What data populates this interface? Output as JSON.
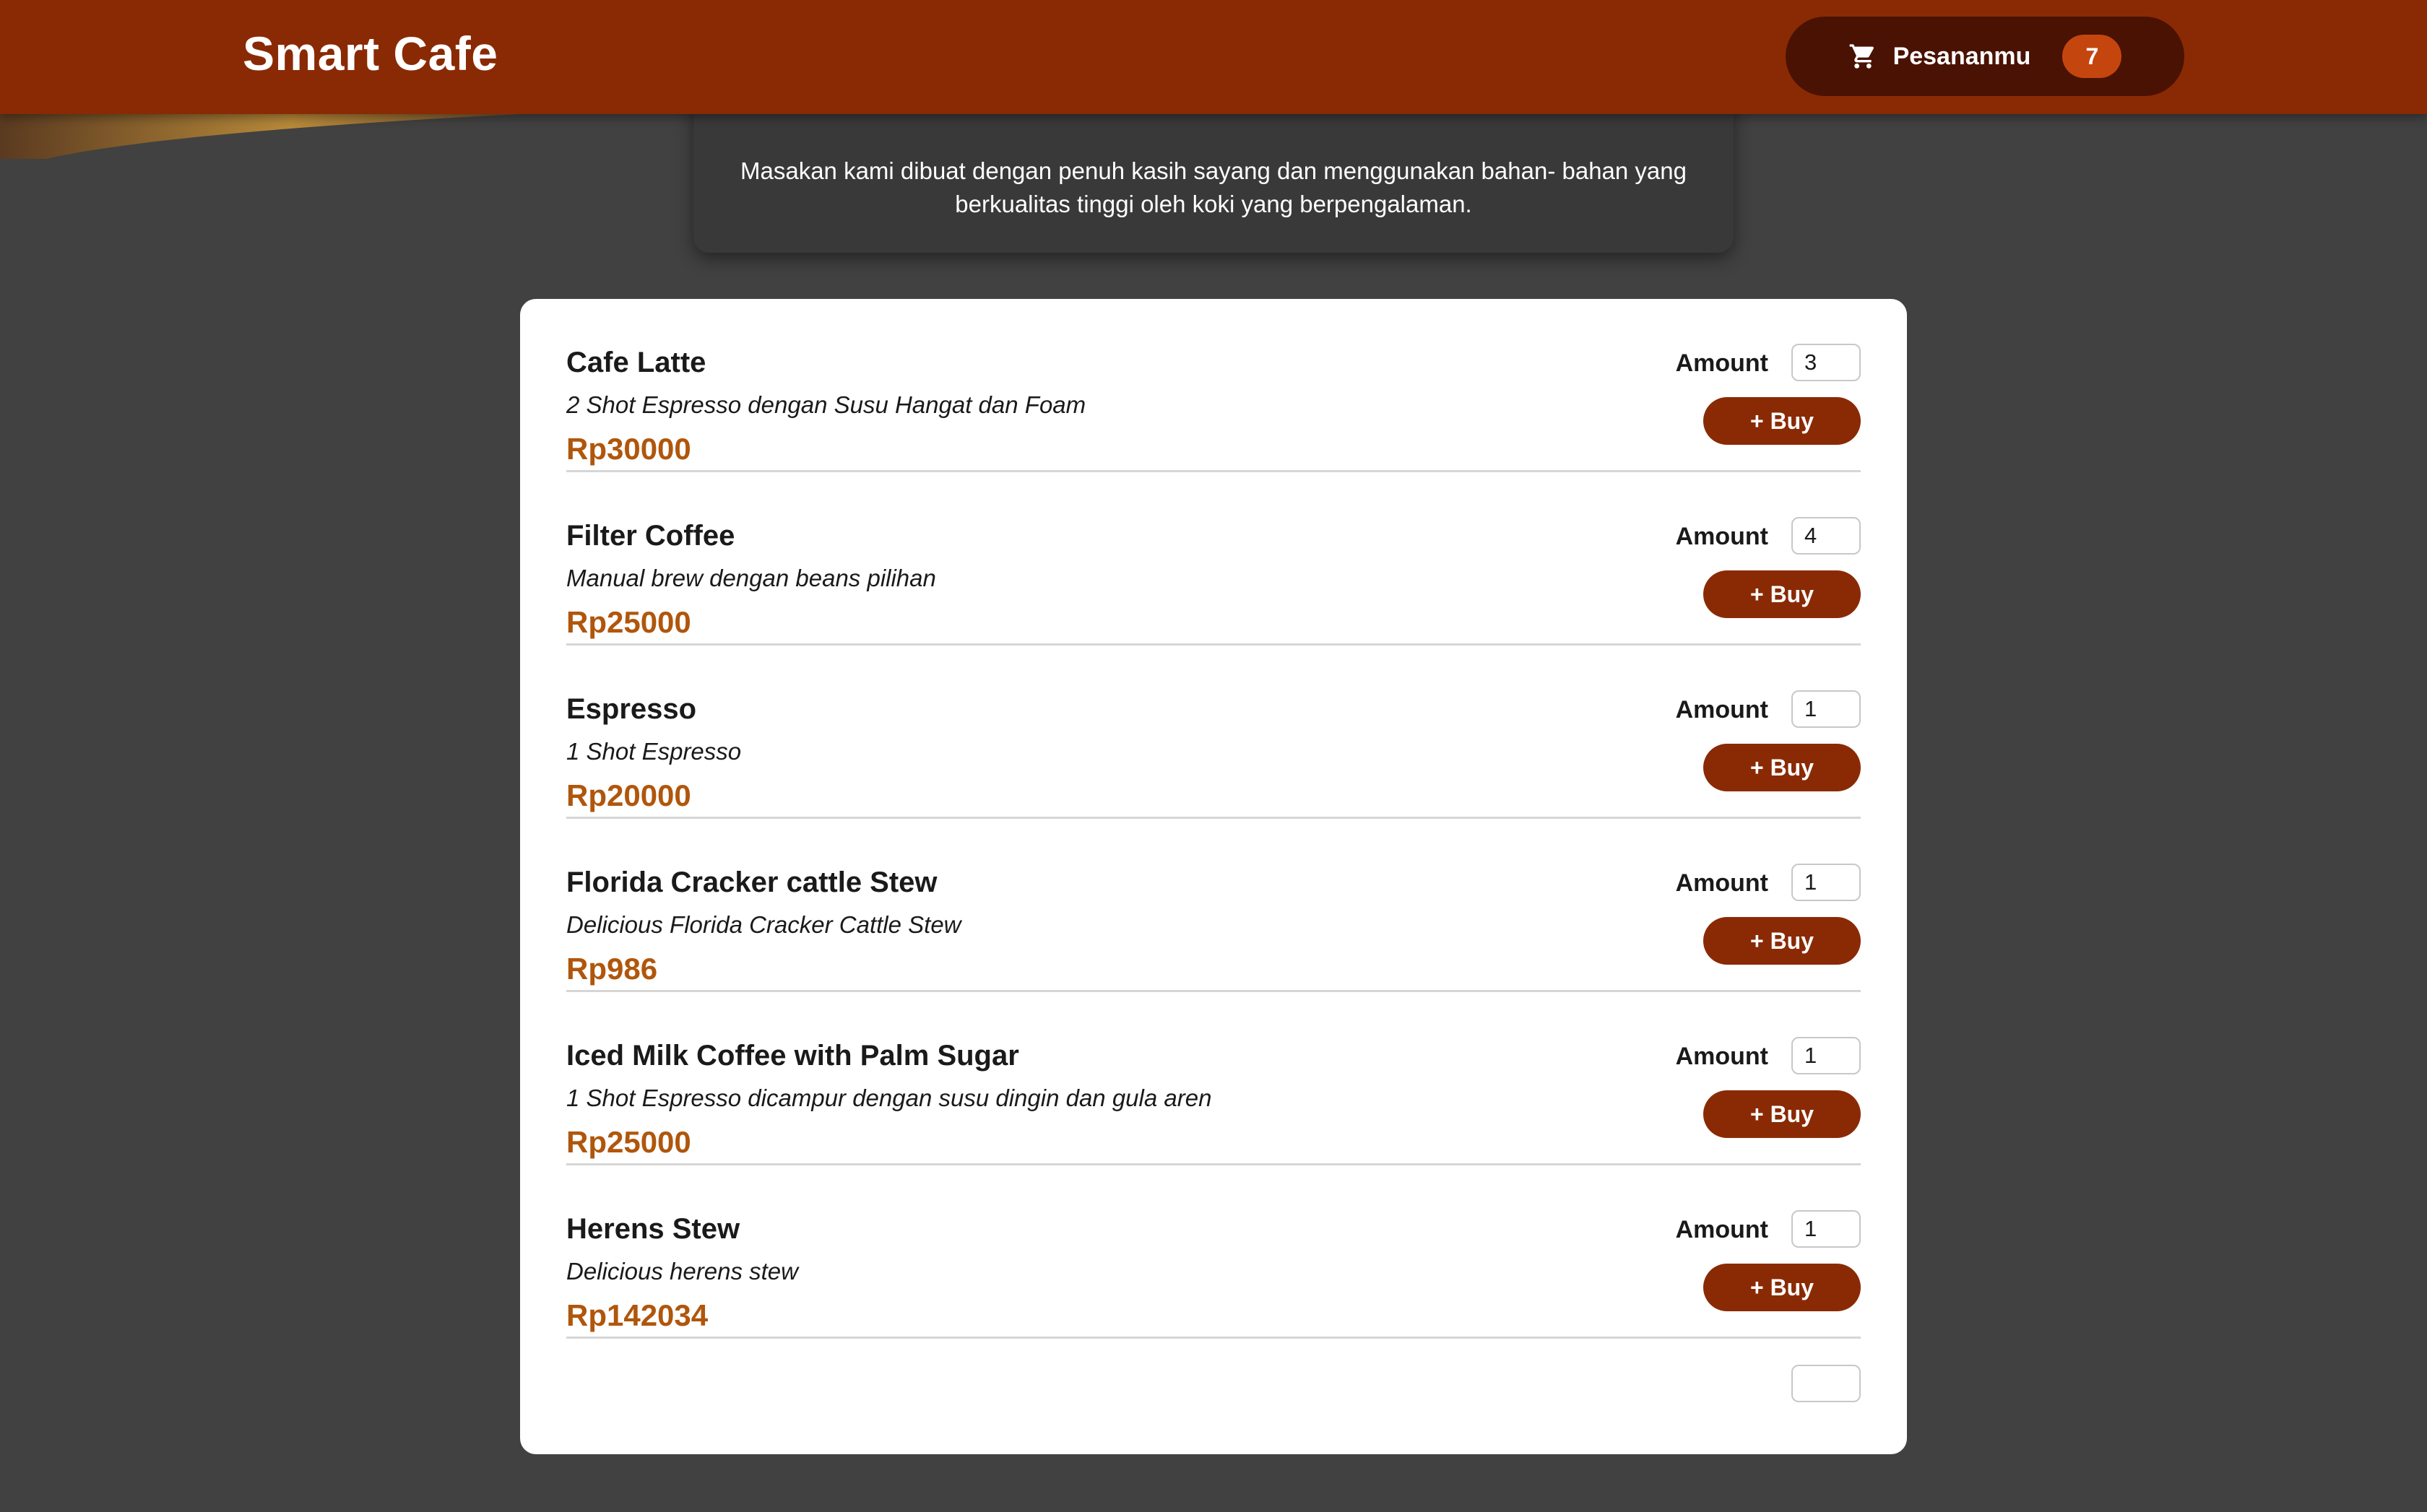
{
  "navbar": {
    "brand": "Smart Cafe",
    "cart_label": "Pesananmu",
    "cart_count": "7"
  },
  "about": {
    "text": "Masakan kami dibuat dengan penuh kasih sayang dan menggunakan bahan- bahan yang berkualitas tinggi oleh koki yang berpengalaman."
  },
  "menu": {
    "amount_label": "Amount",
    "buy_label": "+ Buy",
    "items": [
      {
        "name": "Cafe Latte",
        "description": "2 Shot Espresso dengan Susu Hangat dan Foam",
        "price": "Rp30000",
        "amount": "3"
      },
      {
        "name": "Filter Coffee",
        "description": "Manual brew dengan beans pilihan",
        "price": "Rp25000",
        "amount": "4"
      },
      {
        "name": "Espresso",
        "description": "1 Shot Espresso",
        "price": "Rp20000",
        "amount": "1"
      },
      {
        "name": "Florida Cracker cattle Stew",
        "description": "Delicious Florida Cracker Cattle Stew",
        "price": "Rp986",
        "amount": "1"
      },
      {
        "name": "Iced Milk Coffee with Palm Sugar",
        "description": "1 Shot Espresso dicampur dengan susu dingin dan gula aren",
        "price": "Rp25000",
        "amount": "1"
      },
      {
        "name": "Herens Stew",
        "description": "Delicious herens stew",
        "price": "Rp142034",
        "amount": "1"
      }
    ]
  },
  "colors": {
    "brand": "#8a2a04",
    "cart_button": "#4a1202",
    "badge": "#c4460e",
    "price": "#b0560c",
    "page_background": "#414141"
  },
  "icons": {
    "cart": "shopping-cart-icon"
  }
}
